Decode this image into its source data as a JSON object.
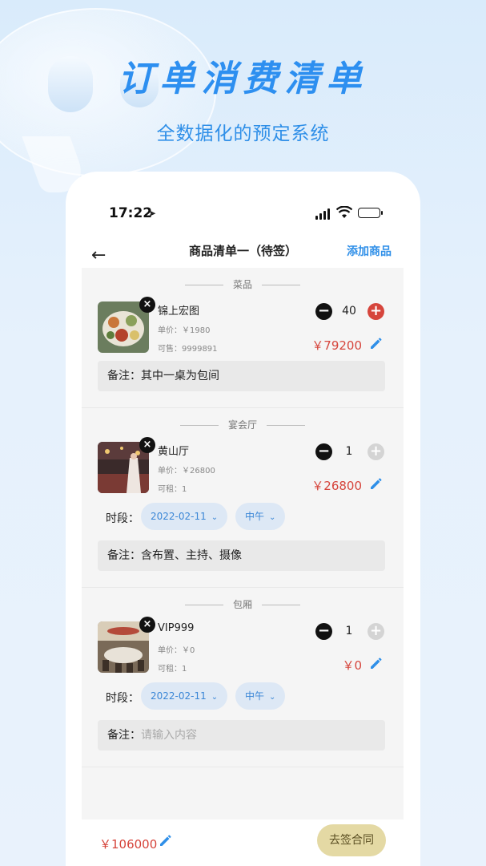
{
  "hero": {
    "title": "订单消费清单",
    "subtitle": "全数据化的预定系统"
  },
  "status_bar": {
    "time": "17:22",
    "location_icon": "location-arrow-icon",
    "signal_icon": "cellular-signal-icon",
    "wifi_icon": "wifi-icon",
    "battery_icon": "battery-icon"
  },
  "navbar": {
    "back_icon": "arrow-left-icon",
    "title": "商品清单一（待签）",
    "action": "添加商品"
  },
  "colors": {
    "accent": "#2f8fe8",
    "price": "#d6453c",
    "sign_button": "#e4d9a4"
  },
  "sections": [
    {
      "heading": "菜品",
      "item": {
        "name": "锦上宏图",
        "unit_price": "单价：￥1980",
        "stock": "可售：9999891",
        "quantity": "40",
        "price": "￥79200",
        "plus_active": true
      },
      "note_label": "备注：",
      "note_value": "其中一桌为包间"
    },
    {
      "heading": "宴会厅",
      "item": {
        "name": "黄山厅",
        "unit_price": "单价：￥26800",
        "stock": "可租：1",
        "quantity": "1",
        "price": "￥26800",
        "plus_active": false
      },
      "period_label": "时段：",
      "date": "2022-02-11",
      "meal": "中午",
      "note_label": "备注：",
      "note_value": "含布置、主持、摄像"
    },
    {
      "heading": "包厢",
      "item": {
        "name": "VIP999",
        "unit_price": "单价：￥0",
        "stock": "可租：1",
        "quantity": "1",
        "price": "￥0",
        "plus_active": false
      },
      "period_label": "时段：",
      "date": "2022-02-11",
      "meal": "中午",
      "note_label": "备注：",
      "note_placeholder": "请输入内容"
    }
  ],
  "footer": {
    "total": "￥106000",
    "sign_button": "去签合同"
  }
}
